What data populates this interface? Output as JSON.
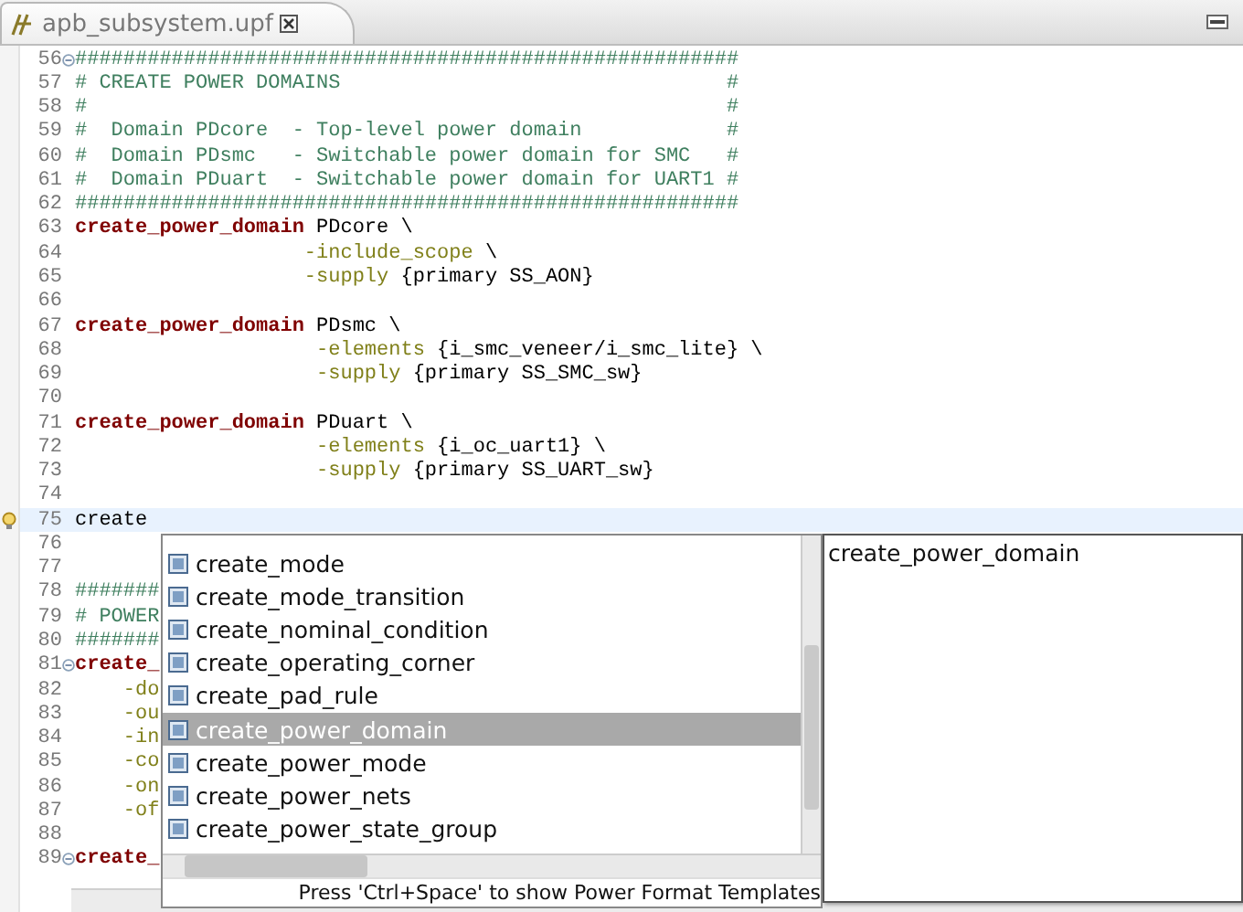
{
  "tab": {
    "title": "apb_subsystem.upf"
  },
  "editor": {
    "lines": [
      {
        "number": "56",
        "foldable": true,
        "current": false,
        "quick_fix": false,
        "segments": [
          {
            "kind": "comment",
            "text": "#######################################################"
          }
        ]
      },
      {
        "number": "57",
        "foldable": false,
        "current": false,
        "quick_fix": false,
        "segments": [
          {
            "kind": "comment",
            "text": "# CREATE POWER DOMAINS                                #"
          }
        ]
      },
      {
        "number": "58",
        "foldable": false,
        "current": false,
        "quick_fix": false,
        "segments": [
          {
            "kind": "comment",
            "text": "#                                                     #"
          }
        ]
      },
      {
        "number": "59",
        "foldable": false,
        "current": false,
        "quick_fix": false,
        "segments": [
          {
            "kind": "comment",
            "text": "#  Domain PDcore  - Top-level power domain            #"
          }
        ]
      },
      {
        "number": "60",
        "foldable": false,
        "current": false,
        "quick_fix": false,
        "segments": [
          {
            "kind": "comment",
            "text": "#  Domain PDsmc   - Switchable power domain for SMC   #"
          }
        ]
      },
      {
        "number": "61",
        "foldable": false,
        "current": false,
        "quick_fix": false,
        "segments": [
          {
            "kind": "comment",
            "text": "#  Domain PDuart  - Switchable power domain for UART1 #"
          }
        ]
      },
      {
        "number": "62",
        "foldable": false,
        "current": false,
        "quick_fix": false,
        "segments": [
          {
            "kind": "comment",
            "text": "#######################################################"
          }
        ]
      },
      {
        "number": "63",
        "foldable": false,
        "current": false,
        "quick_fix": false,
        "segments": [
          {
            "kind": "keyword",
            "text": "create_power_domain"
          },
          {
            "kind": "plain",
            "text": " PDcore \\"
          }
        ]
      },
      {
        "number": "64",
        "foldable": false,
        "current": false,
        "quick_fix": false,
        "segments": [
          {
            "kind": "option",
            "text": "                   -include_scope"
          },
          {
            "kind": "plain",
            "text": " \\"
          }
        ]
      },
      {
        "number": "65",
        "foldable": false,
        "current": false,
        "quick_fix": false,
        "segments": [
          {
            "kind": "option",
            "text": "                   -supply"
          },
          {
            "kind": "plain",
            "text": " {primary SS_AON}"
          }
        ]
      },
      {
        "number": "66",
        "foldable": false,
        "current": false,
        "quick_fix": false
      },
      {
        "number": "67",
        "foldable": false,
        "current": false,
        "quick_fix": false,
        "segments": [
          {
            "kind": "keyword",
            "text": "create_power_domain"
          },
          {
            "kind": "plain",
            "text": " PDsmc \\"
          }
        ]
      },
      {
        "number": "68",
        "foldable": false,
        "current": false,
        "quick_fix": false,
        "segments": [
          {
            "kind": "option",
            "text": "                    -elements"
          },
          {
            "kind": "plain",
            "text": " {i_smc_veneer/i_smc_lite} \\"
          }
        ]
      },
      {
        "number": "69",
        "foldable": false,
        "current": false,
        "quick_fix": false,
        "segments": [
          {
            "kind": "option",
            "text": "                    -supply"
          },
          {
            "kind": "plain",
            "text": " {primary SS_SMC_sw}"
          }
        ]
      },
      {
        "number": "70",
        "foldable": false,
        "current": false,
        "quick_fix": false
      },
      {
        "number": "71",
        "foldable": false,
        "current": false,
        "quick_fix": false,
        "segments": [
          {
            "kind": "keyword",
            "text": "create_power_domain"
          },
          {
            "kind": "plain",
            "text": " PDuart \\"
          }
        ]
      },
      {
        "number": "72",
        "foldable": false,
        "current": false,
        "quick_fix": false,
        "segments": [
          {
            "kind": "option",
            "text": "                    -elements"
          },
          {
            "kind": "plain",
            "text": " {i_oc_uart1} \\"
          }
        ]
      },
      {
        "number": "73",
        "foldable": false,
        "current": false,
        "quick_fix": false,
        "segments": [
          {
            "kind": "option",
            "text": "                    -supply"
          },
          {
            "kind": "plain",
            "text": " {primary SS_UART_sw}"
          }
        ]
      },
      {
        "number": "74",
        "foldable": false,
        "current": false,
        "quick_fix": false
      },
      {
        "number": "75",
        "foldable": false,
        "current": true,
        "quick_fix": true,
        "segments": [
          {
            "kind": "plain",
            "text": "create"
          }
        ]
      },
      {
        "number": "76",
        "foldable": false,
        "current": false,
        "quick_fix": false
      },
      {
        "number": "77",
        "foldable": false,
        "current": false,
        "quick_fix": false
      },
      {
        "number": "78",
        "foldable": false,
        "current": false,
        "quick_fix": false,
        "segments": [
          {
            "kind": "comment",
            "text": "#######"
          }
        ]
      },
      {
        "number": "79",
        "foldable": false,
        "current": false,
        "quick_fix": false,
        "segments": [
          {
            "kind": "comment",
            "text": "# POWER"
          }
        ]
      },
      {
        "number": "80",
        "foldable": false,
        "current": false,
        "quick_fix": false,
        "segments": [
          {
            "kind": "comment",
            "text": "#######"
          }
        ]
      },
      {
        "number": "81",
        "foldable": true,
        "current": false,
        "quick_fix": false,
        "segments": [
          {
            "kind": "keyword",
            "text": "create_"
          }
        ]
      },
      {
        "number": "82",
        "foldable": false,
        "current": false,
        "quick_fix": false,
        "segments": [
          {
            "kind": "option",
            "text": "    -do"
          }
        ]
      },
      {
        "number": "83",
        "foldable": false,
        "current": false,
        "quick_fix": false,
        "segments": [
          {
            "kind": "option",
            "text": "    -ou"
          }
        ]
      },
      {
        "number": "84",
        "foldable": false,
        "current": false,
        "quick_fix": false,
        "segments": [
          {
            "kind": "option",
            "text": "    -in"
          }
        ]
      },
      {
        "number": "85",
        "foldable": false,
        "current": false,
        "quick_fix": false,
        "segments": [
          {
            "kind": "option",
            "text": "    -co"
          }
        ]
      },
      {
        "number": "86",
        "foldable": false,
        "current": false,
        "quick_fix": false,
        "segments": [
          {
            "kind": "option",
            "text": "    -on"
          }
        ]
      },
      {
        "number": "87",
        "foldable": false,
        "current": false,
        "quick_fix": false,
        "segments": [
          {
            "kind": "option",
            "text": "    -of"
          }
        ]
      },
      {
        "number": "88",
        "foldable": false,
        "current": false,
        "quick_fix": false
      },
      {
        "number": "89",
        "foldable": true,
        "current": false,
        "quick_fix": false,
        "segments": [
          {
            "kind": "keyword",
            "text": "create_"
          }
        ]
      }
    ]
  },
  "completion": {
    "items": [
      {
        "label": "create_mode",
        "selected": false
      },
      {
        "label": "create_mode_transition",
        "selected": false
      },
      {
        "label": "create_nominal_condition",
        "selected": false
      },
      {
        "label": "create_operating_corner",
        "selected": false
      },
      {
        "label": "create_pad_rule",
        "selected": false
      },
      {
        "label": "create_power_domain",
        "selected": true
      },
      {
        "label": "create_power_mode",
        "selected": false
      },
      {
        "label": "create_power_nets",
        "selected": false
      },
      {
        "label": "create_power_state_group",
        "selected": false
      }
    ],
    "hint": "Press 'Ctrl+Space' to show Power Format Templates",
    "detail": "create_power_domain"
  }
}
